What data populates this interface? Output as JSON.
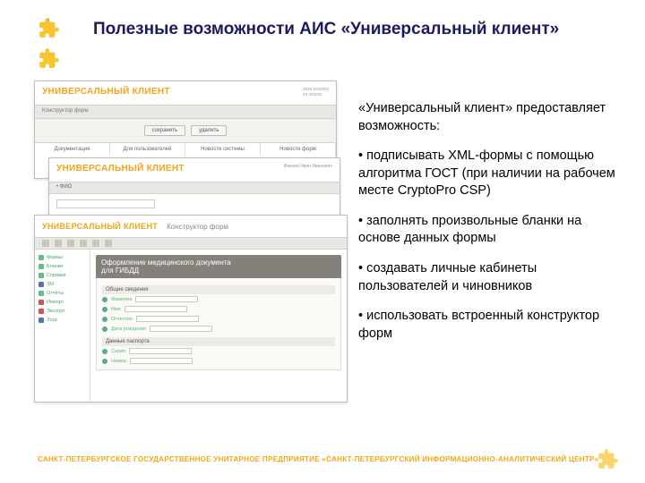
{
  "title": "Полезные возможности АИС «Универсальный клиент»",
  "right": {
    "lead": "«Универсальный клиент» предоставляет возможность:",
    "bullets": [
      "• подписывать XML-формы с помощью алгоритма ГОСТ (при наличии на рабочем месте CryptoPro CSP)",
      "• заполнять произвольные бланки на основе данных формы",
      "• создавать личные кабинеты пользователей и чиновников",
      "• использовать встроенный конструктор форм"
    ]
  },
  "footer": "САНКТ-ПЕТЕРБУРГСКОЕ ГОСУДАРСТВЕННОЕ УНИТАРНОЕ ПРЕДПРИЯТИЕ «САНКТ-ПЕТЕРБУРГСКИЙ ИНФОРМАЦИОННО-АНАЛИТИЧЕСКИЙ ЦЕНТР»",
  "shots": {
    "brand": "УНИВЕРСАЛЬНЫЙ КЛИЕНТ",
    "s1": {
      "sub": "Конструктор форм",
      "btn1": "сохранить",
      "btn2": "удалить",
      "tabs": [
        "Документация",
        "Для пользователей",
        "Новости системы",
        "Новости форм"
      ]
    },
    "s2": {
      "strip": "• ФИО",
      "body": "Иванов Иван Иванович"
    },
    "s3": {
      "crumb": "Конструктор форм",
      "panel_title1": "Оформление медицинского документа",
      "panel_title2": "для ГИБДД",
      "sect1": "Общие сведения",
      "sect2": "Данные паспорта",
      "side": [
        "Формы",
        "Бланки",
        "Справки",
        "ЗМ",
        "Отчёты",
        "Импорт",
        "Экспорт",
        "Логи"
      ],
      "fields": [
        "Фамилия",
        "Имя",
        "Отчество",
        "Дата рождения",
        "Серия",
        "Номер"
      ]
    }
  }
}
